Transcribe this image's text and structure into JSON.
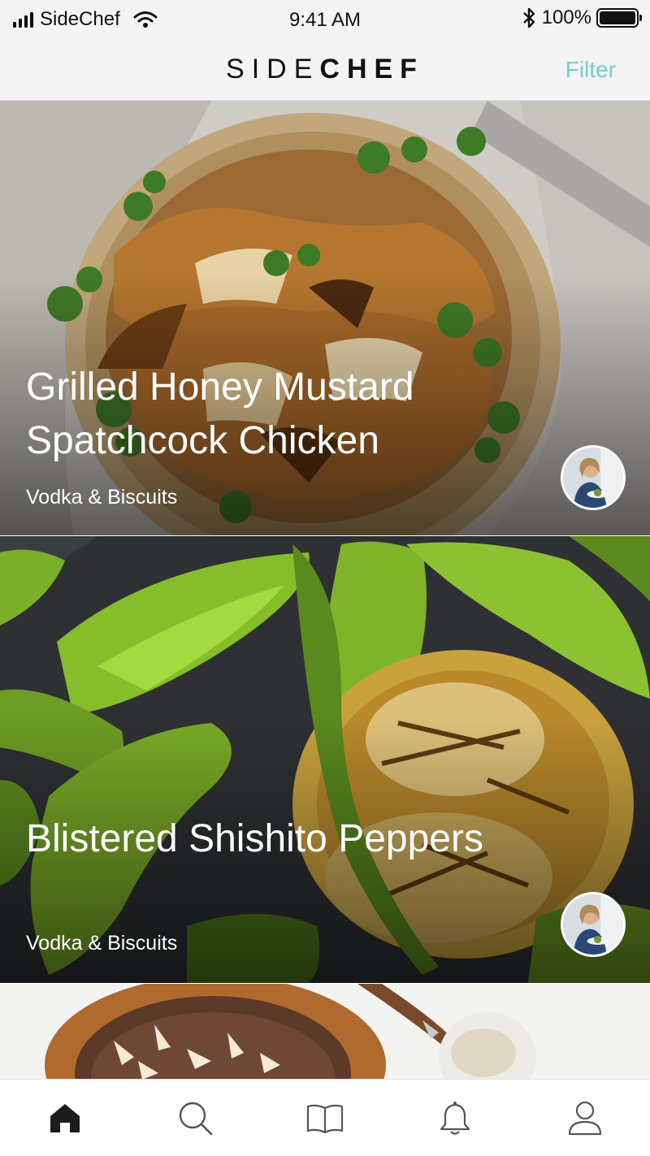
{
  "status_bar": {
    "carrier": "SideChef",
    "time": "9:41 AM",
    "battery_percent": "100%",
    "icons": [
      "signal-icon",
      "wifi-icon",
      "bluetooth-icon",
      "battery-icon"
    ]
  },
  "header": {
    "logo_light": "SIDE",
    "logo_bold": "CHEF",
    "filter_label": "Filter",
    "accent_color": "#6fcfcf"
  },
  "recipes": [
    {
      "title": "Grilled Honey Mustard Spatchcock Chicken",
      "author": "Vodka & Biscuits"
    },
    {
      "title": "Blistered Shishito Peppers",
      "author": "Vodka & Biscuits"
    }
  ],
  "tab_bar": {
    "tabs": [
      "home-icon",
      "search-icon",
      "book-icon",
      "bell-icon",
      "profile-icon"
    ],
    "active": "home-icon"
  }
}
